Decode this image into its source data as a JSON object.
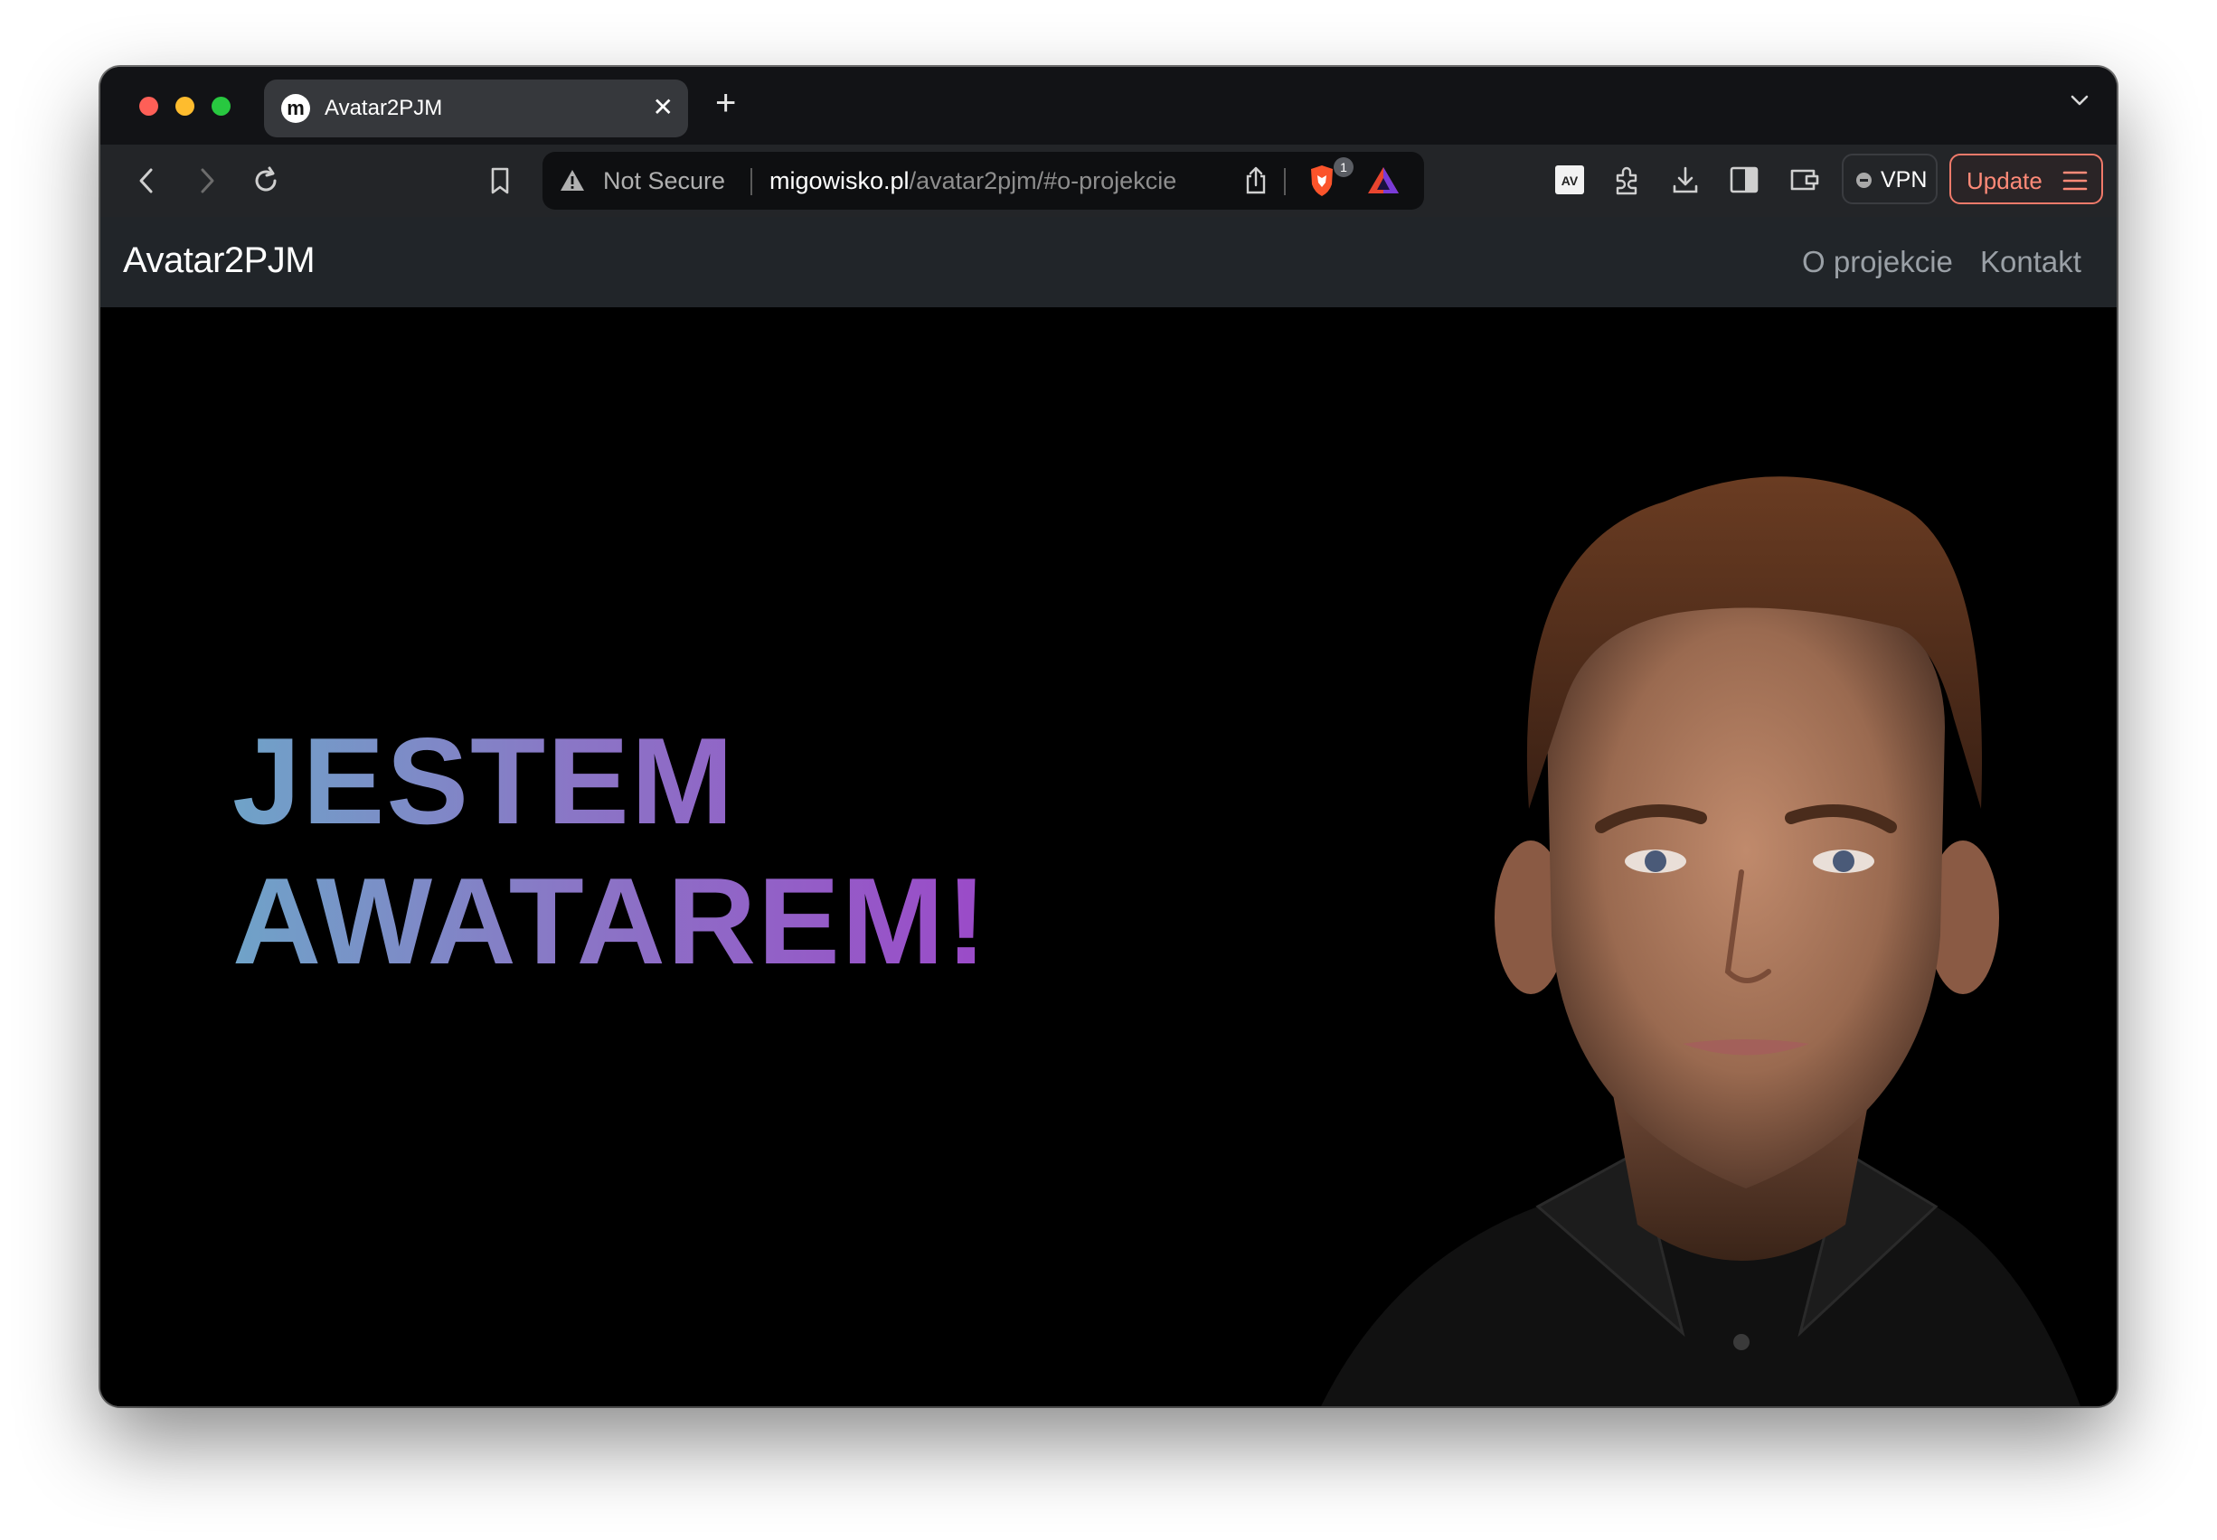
{
  "browser": {
    "tab": {
      "title": "Avatar2PJM",
      "favicon_letter": "m"
    },
    "address_bar": {
      "security_label": "Not Secure",
      "url_domain": "migowisko.pl",
      "url_path": "/avatar2pjm/#o-projekcie"
    },
    "shields_badge_count": "1",
    "vpn_label": "VPN",
    "update_label": "Update"
  },
  "site": {
    "brand": "Avatar2PJM",
    "nav": [
      {
        "label": "O projekcie"
      },
      {
        "label": "Kontakt"
      }
    ],
    "hero": {
      "line1": "JESTEM",
      "line2": "AWATAREM!"
    }
  },
  "colors": {
    "headline_gradient_start": "#6fa3c8",
    "headline_gradient_end": "#9b4ac8",
    "update_accent": "#f07a6a"
  },
  "icons": [
    "back-icon",
    "forward-icon",
    "reload-icon",
    "bookmark-icon",
    "warning-icon",
    "share-icon",
    "brave-shields-icon",
    "brave-rewards-icon",
    "avtools-extension-icon",
    "extensions-icon",
    "downloads-icon",
    "sidebar-icon",
    "wallet-icon",
    "menu-icon",
    "tab-list-chevron-icon"
  ]
}
